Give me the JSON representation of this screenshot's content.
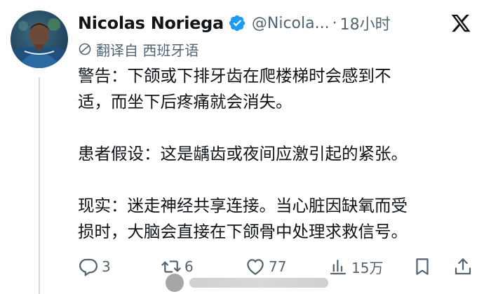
{
  "tweet": {
    "display_name": "Nicolas Noriega",
    "handle": "@Nicola...",
    "separator": "·",
    "time": "18小时",
    "translated_from": "翻译自 西班牙语",
    "paragraphs": [
      [
        "警告：下颌或下排牙齿在爬楼梯时会感到不",
        "适，而坐下后疼痛就会消失。"
      ],
      [
        "患者假设：这是龋齿或夜间应激引起的紧张。"
      ],
      [
        "现实：迷走神经共享连接。当心脏因缺氧而受",
        "损时，大脑会直接在下颌骨中处理求救信号。"
      ]
    ]
  },
  "actions": {
    "replies": "3",
    "reposts": "6",
    "likes": "77",
    "views": "15万"
  },
  "icons": {
    "verified": "verified-badge-icon",
    "brand": "x-logo-icon",
    "translate": "globe-icon",
    "reply": "reply-icon",
    "repost": "repost-icon",
    "like": "heart-icon",
    "views": "views-chart-icon",
    "bookmark": "bookmark-icon",
    "share": "share-icon"
  },
  "colors": {
    "text": "#0f1419",
    "secondary": "#536471",
    "verified": "#1d9bf0",
    "thread_line": "#cfd9de"
  }
}
